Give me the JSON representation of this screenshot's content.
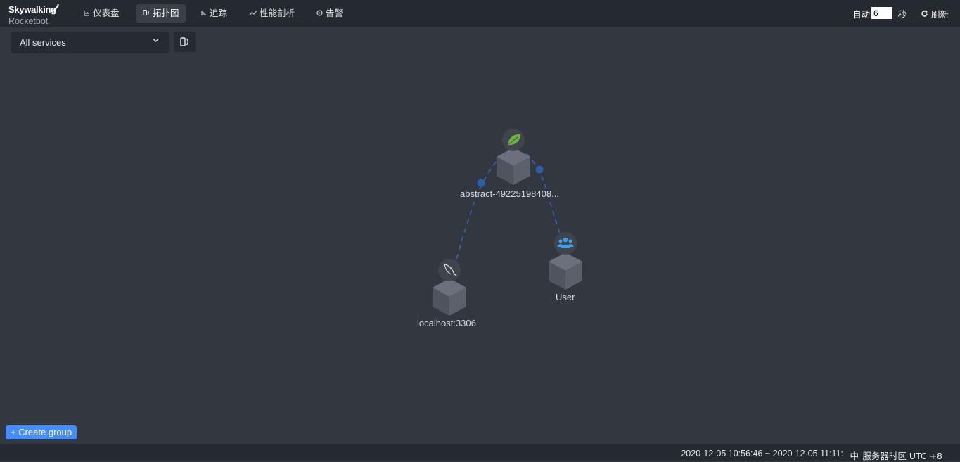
{
  "brand": {
    "name_top": "Skywalking",
    "name_bottom": "Rocketbot"
  },
  "nav": {
    "items": [
      {
        "label": "仪表盘",
        "icon": "dashboard-icon",
        "active": false
      },
      {
        "label": "拓扑图",
        "icon": "topology-icon",
        "active": true
      },
      {
        "label": "追踪",
        "icon": "trace-icon",
        "active": false
      },
      {
        "label": "性能剖析",
        "icon": "profile-icon",
        "active": false
      },
      {
        "label": "告警",
        "icon": "alarm-icon",
        "active": false
      }
    ]
  },
  "refresh": {
    "auto_label": "自动",
    "interval_value": "6",
    "unit_label": "秒",
    "refresh_label": "刷新"
  },
  "toolbar": {
    "service_select_value": "All services"
  },
  "topology": {
    "nodes": [
      {
        "name": "abstract-49225198408...",
        "icon": "spring-leaf-icon",
        "icon_color": "#6db33f"
      },
      {
        "name": "localhost:3306",
        "icon": "mysql-dolphin-icon",
        "icon_color": "#d8dbe0"
      },
      {
        "name": "User",
        "icon": "users-icon",
        "icon_color": "#3aa0f0"
      }
    ],
    "edge_color": "#2f66b8"
  },
  "create_group_label": "+ Create group",
  "footer": {
    "time_range": "2020-12-05 10:56:46 ~ 2020-12-05 11:11:",
    "lang": "中",
    "timezone": "服务器时区 UTC +8"
  },
  "colors": {
    "background": "#333740",
    "bar": "#252a31",
    "accent": "#448dfe"
  }
}
